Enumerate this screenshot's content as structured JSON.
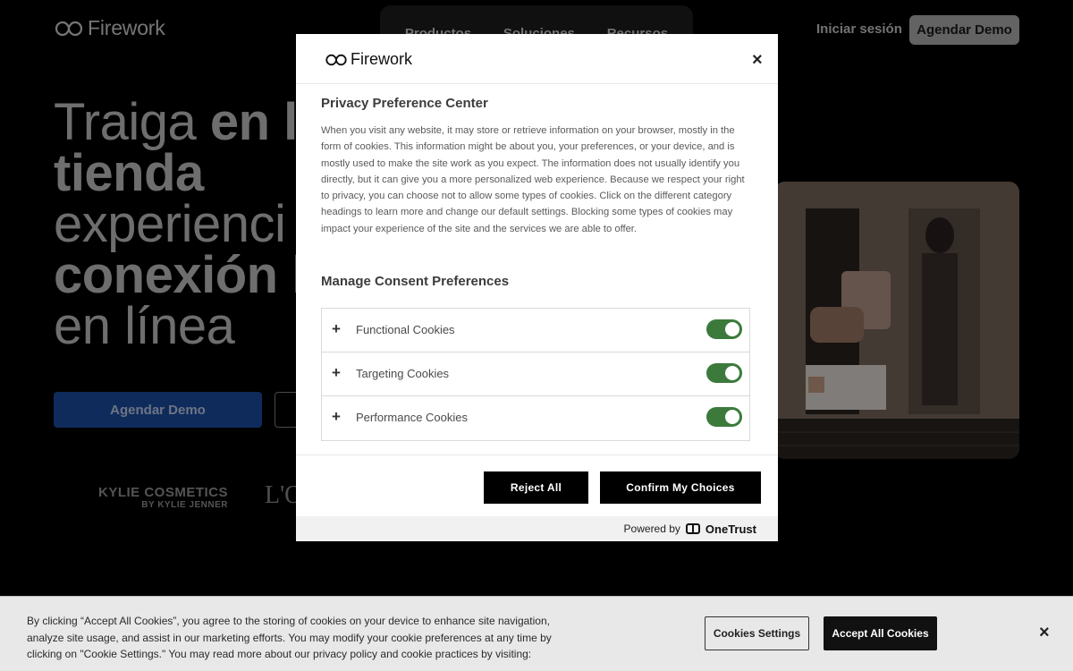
{
  "site": {
    "logo_text": "Firework",
    "nav": [
      "Productos",
      "Soluciones",
      "Recursos"
    ],
    "login": "Iniciar sesión",
    "header_demo": "Agendar Demo",
    "hero_lines": [
      {
        "text": "Traiga ",
        "bold": "en l"
      },
      {
        "text": "",
        "bold": "tienda"
      },
      {
        "text": "experienci",
        "bold": ""
      },
      {
        "text": "",
        "bold": "conexión l"
      },
      {
        "text": "en línea",
        "bold": ""
      }
    ],
    "hero_demo": "Agendar Demo",
    "brand_kylie_1": "KYLIE COSMETICS",
    "brand_kylie_2": "BY KYLIE JENNER",
    "brand_loreal": "L'O"
  },
  "modal": {
    "logo_text": "Firework",
    "close": "×",
    "title": "Privacy Preference Center",
    "description": "When you visit any website, it may store or retrieve information on your browser, mostly in the form of cookies. This information might be about you, your preferences, or your device, and is mostly used to make the site work as you expect. The information does not usually identify you directly, but it can give you a more personalized web experience. Because we respect your right to privacy, you can choose not to allow some types of cookies. Click on the different category headings to learn more and change our default settings. Blocking some types of cookies may impact your experience of the site and the services we are able to offer.",
    "manage_title": "Manage Consent Preferences",
    "categories": [
      {
        "label": "Functional Cookies",
        "enabled": true
      },
      {
        "label": "Targeting Cookies",
        "enabled": true
      },
      {
        "label": "Performance Cookies",
        "enabled": true
      }
    ],
    "reject_label": "Reject All",
    "confirm_label": "Confirm My Choices",
    "powered_by": "Powered by",
    "powered_brand": "OneTrust",
    "toggle_color": "#3c7a3c"
  },
  "banner": {
    "text": "By clicking “Accept All Cookies”, you agree to the storing of cookies on your device to enhance site navigation, analyze site usage, and assist in our marketing efforts. You may modify your cookie preferences at any time by clicking on \"Cookie Settings.\" You may read more about our privacy policy and cookie practices by visiting:",
    "settings_label": "Cookies Settings",
    "accept_label": "Accept All Cookies",
    "close": "×"
  }
}
